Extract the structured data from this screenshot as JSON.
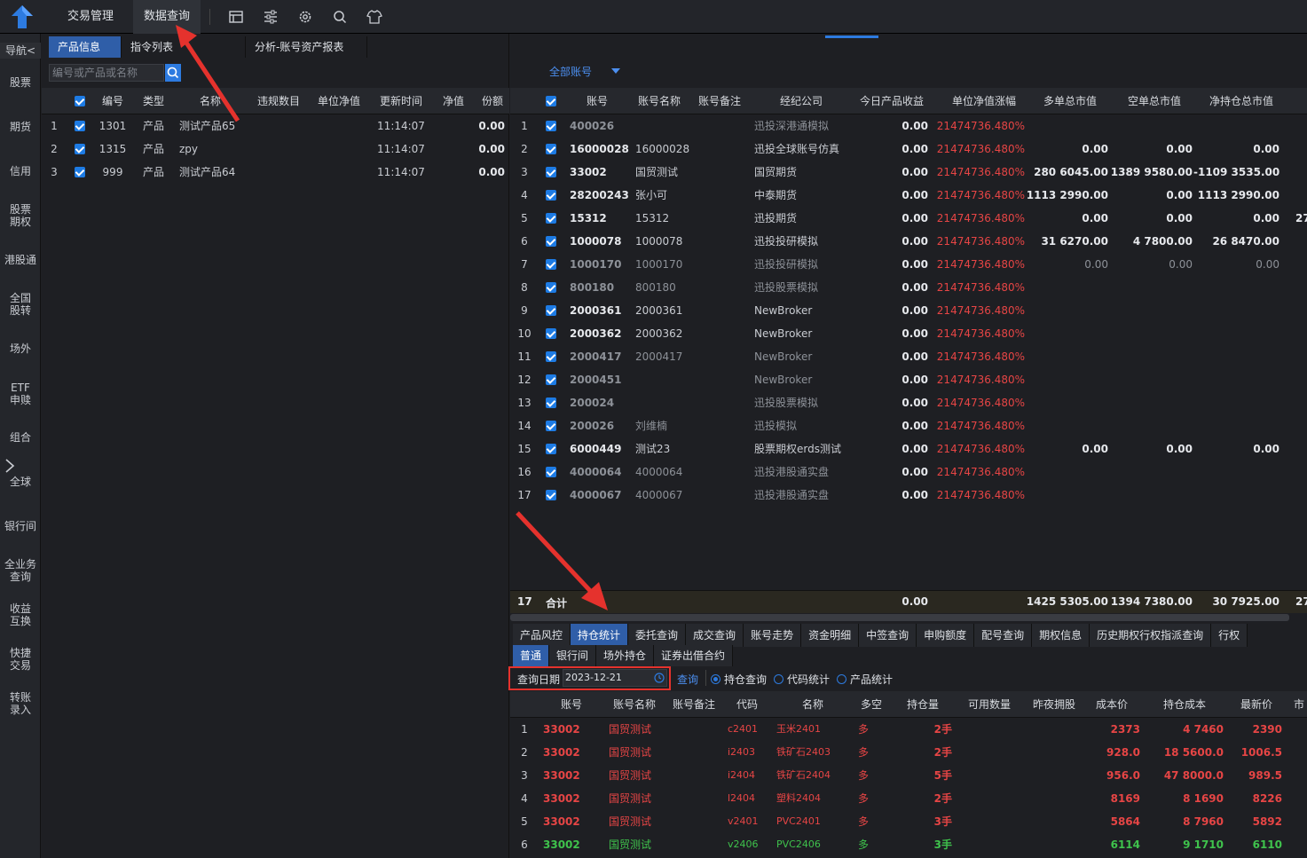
{
  "top_menu": {
    "trade": "交易管理",
    "data_query": "数据查询"
  },
  "sidebar": {
    "nav": "导航<",
    "items": [
      "股票",
      "期货",
      "信用",
      "股票\n期权",
      "港股通",
      "全国\n股转",
      "场外",
      "ETF\n申赎",
      "组合",
      "全球",
      "银行间",
      "全业务\n查询",
      "收益\n互换",
      "快捷\n交易",
      "转账\n录入"
    ]
  },
  "left_tabs": [
    "产品信息",
    "指令列表",
    "分析-账号资产报表"
  ],
  "left_search_placeholder": "编号或产品或名称",
  "left_headers": [
    "编号",
    "类型",
    "名称",
    "违规数目",
    "单位净值",
    "更新时间",
    "净值",
    "份额"
  ],
  "left_rows": [
    {
      "idx": "1",
      "code": "1301",
      "type": "产品",
      "name": "测试产品65",
      "time": "11:14:07",
      "share": "0.00"
    },
    {
      "idx": "2",
      "code": "1315",
      "type": "产品",
      "name": "zpy",
      "time": "11:14:07",
      "share": "0.00"
    },
    {
      "idx": "3",
      "code": "999",
      "type": "产品",
      "name": "测试产品64",
      "time": "11:14:07",
      "share": "0.00"
    }
  ],
  "right_filter": "全部账号",
  "right_headers": [
    "账号",
    "账号名称",
    "账号备注",
    "经纪公司",
    "今日产品收益",
    "单位净值涨幅",
    "多单总市值",
    "空单总市值",
    "净持仓总市值"
  ],
  "right_rows": [
    {
      "idx": "1",
      "acct": "400026",
      "name": "",
      "broker": "迅投深港通模拟",
      "income": "0.00",
      "rise": "21474736.480%",
      "long": "",
      "short": "",
      "net": "",
      "dim": true
    },
    {
      "idx": "2",
      "acct": "16000028",
      "name": "16000028",
      "broker": "迅投全球账号仿真",
      "income": "0.00",
      "rise": "21474736.480%",
      "long": "0.00",
      "short": "0.00",
      "net": "0.00",
      "dim": false
    },
    {
      "idx": "3",
      "acct": "33002",
      "name": "国贸测试",
      "broker": "国贸期货",
      "income": "0.00",
      "rise": "21474736.480%",
      "long": "280 6045.00",
      "short": "1389 9580.00",
      "net": "-1109 3535.00",
      "dim": false
    },
    {
      "idx": "4",
      "acct": "28200243",
      "name": "张小可",
      "broker": "中泰期货",
      "income": "0.00",
      "rise": "21474736.480%",
      "long": "1113 2990.00",
      "short": "0.00",
      "net": "1113 2990.00",
      "dim": false
    },
    {
      "idx": "5",
      "acct": "15312",
      "name": "15312",
      "broker": "迅投期货",
      "income": "0.00",
      "rise": "21474736.480%",
      "long": "0.00",
      "short": "0.00",
      "net": "0.00",
      "dim": false
    },
    {
      "idx": "6",
      "acct": "1000078",
      "name": "1000078",
      "broker": "迅投投研模拟",
      "income": "0.00",
      "rise": "21474736.480%",
      "long": "31 6270.00",
      "short": "4 7800.00",
      "net": "26 8470.00",
      "dim": false
    },
    {
      "idx": "7",
      "acct": "1000170",
      "name": "1000170",
      "broker": "迅投投研模拟",
      "income": "0.00",
      "rise": "21474736.480%",
      "long": "0.00",
      "short": "0.00",
      "net": "0.00",
      "dim": true
    },
    {
      "idx": "8",
      "acct": "800180",
      "name": "800180",
      "broker": "迅投股票模拟",
      "income": "0.00",
      "rise": "21474736.480%",
      "long": "",
      "short": "",
      "net": "",
      "dim": true
    },
    {
      "idx": "9",
      "acct": "2000361",
      "name": "2000361",
      "broker": "NewBroker",
      "income": "0.00",
      "rise": "21474736.480%",
      "long": "",
      "short": "",
      "net": "",
      "dim": false
    },
    {
      "idx": "10",
      "acct": "2000362",
      "name": "2000362",
      "broker": "NewBroker",
      "income": "0.00",
      "rise": "21474736.480%",
      "long": "",
      "short": "",
      "net": "",
      "dim": false
    },
    {
      "idx": "11",
      "acct": "2000417",
      "name": "2000417",
      "broker": "NewBroker",
      "income": "0.00",
      "rise": "21474736.480%",
      "long": "",
      "short": "",
      "net": "",
      "dim": true
    },
    {
      "idx": "12",
      "acct": "2000451",
      "name": "",
      "broker": "NewBroker",
      "income": "0.00",
      "rise": "21474736.480%",
      "long": "",
      "short": "",
      "net": "",
      "dim": true
    },
    {
      "idx": "13",
      "acct": "200024",
      "name": "",
      "broker": "迅投股票模拟",
      "income": "0.00",
      "rise": "21474736.480%",
      "long": "",
      "short": "",
      "net": "",
      "dim": true
    },
    {
      "idx": "14",
      "acct": "200026",
      "name": "刘维楠",
      "broker": "迅投模拟",
      "income": "0.00",
      "rise": "21474736.480%",
      "long": "",
      "short": "",
      "net": "",
      "dim": true
    },
    {
      "idx": "15",
      "acct": "6000449",
      "name": "测试23",
      "broker": "股票期权erds测试",
      "income": "0.00",
      "rise": "21474736.480%",
      "long": "0.00",
      "short": "0.00",
      "net": "0.00",
      "dim": false
    },
    {
      "idx": "16",
      "acct": "4000064",
      "name": "4000064",
      "broker": "迅投港股通实盘",
      "income": "0.00",
      "rise": "21474736.480%",
      "long": "",
      "short": "",
      "net": "",
      "dim": true
    },
    {
      "idx": "17",
      "acct": "4000067",
      "name": "4000067",
      "broker": "迅投港股通实盘",
      "income": "0.00",
      "rise": "21474736.480%",
      "long": "",
      "short": "",
      "net": "",
      "dim": true
    }
  ],
  "total": {
    "count": "17",
    "label": "合计",
    "income": "0.00",
    "long": "1425 5305.00",
    "short": "1394 7380.00",
    "net": "30 7925.00",
    "more": "27"
  },
  "extra_col": "27",
  "bottom_tabs": [
    "产品风控",
    "持仓统计",
    "委托查询",
    "成交查询",
    "账号走势",
    "资金明细",
    "中签查询",
    "申购额度",
    "配号查询",
    "期权信息",
    "历史期权行权指派查询",
    "行权"
  ],
  "sub_tabs": [
    "普通",
    "银行间",
    "场外持仓",
    "证券出借合约"
  ],
  "query": {
    "date_label": "查询日期",
    "date_value": "2023-12-21",
    "query_btn": "查询",
    "radio_pos": "持仓查询",
    "radio_code": "代码统计",
    "radio_product": "产品统计"
  },
  "pos_headers": [
    "账号",
    "账号名称",
    "账号备注",
    "代码",
    "名称",
    "多空",
    "持仓量",
    "可用数量",
    "昨夜拥股",
    "成本价",
    "持仓成本",
    "最新价",
    "市"
  ],
  "pos_rows": [
    {
      "idx": "1",
      "acct": "33002",
      "name": "国贸测试",
      "code": "c2401",
      "sname": "玉米2401",
      "dir": "多",
      "qty": "2手",
      "cost": "2373",
      "pcost": "4 7460",
      "last": "2390",
      "color": "red"
    },
    {
      "idx": "2",
      "acct": "33002",
      "name": "国贸测试",
      "code": "i2403",
      "sname": "铁矿石2403",
      "dir": "多",
      "qty": "2手",
      "cost": "928.0",
      "pcost": "18 5600.0",
      "last": "1006.5",
      "color": "red"
    },
    {
      "idx": "3",
      "acct": "33002",
      "name": "国贸测试",
      "code": "i2404",
      "sname": "铁矿石2404",
      "dir": "多",
      "qty": "5手",
      "cost": "956.0",
      "pcost": "47 8000.0",
      "last": "989.5",
      "color": "red"
    },
    {
      "idx": "4",
      "acct": "33002",
      "name": "国贸测试",
      "code": "l2404",
      "sname": "塑料2404",
      "dir": "多",
      "qty": "2手",
      "cost": "8169",
      "pcost": "8 1690",
      "last": "8226",
      "color": "red"
    },
    {
      "idx": "5",
      "acct": "33002",
      "name": "国贸测试",
      "code": "v2401",
      "sname": "PVC2401",
      "dir": "多",
      "qty": "3手",
      "cost": "5864",
      "pcost": "8 7960",
      "last": "5892",
      "color": "red"
    },
    {
      "idx": "6",
      "acct": "33002",
      "name": "国贸测试",
      "code": "v2406",
      "sname": "PVC2406",
      "dir": "多",
      "qty": "3手",
      "cost": "6114",
      "pcost": "9 1710",
      "last": "6110",
      "color": "green"
    }
  ],
  "colors": {
    "accent": "#2f5ea8",
    "red": "#e64545",
    "green": "#3fc24c",
    "annotation": "#e5322d"
  }
}
